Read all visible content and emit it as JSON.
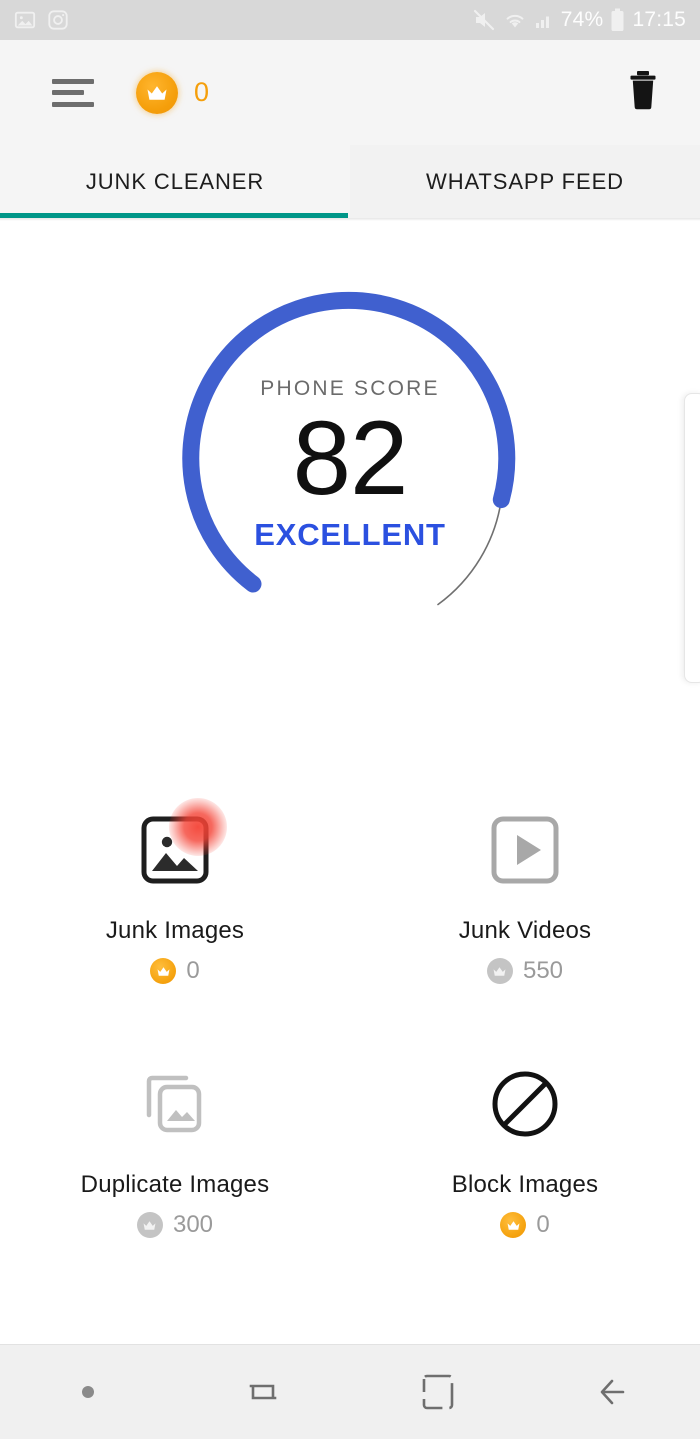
{
  "status_bar": {
    "left_icons": [
      "gallery-icon",
      "camera-icon"
    ],
    "mute_icon": "mute-icon",
    "wifi_icon": "wifi-icon",
    "signal_icon": "cellular-signal-icon",
    "battery_percent": "74%",
    "battery_icon": "battery-icon",
    "time": "17:15"
  },
  "toolbar": {
    "menu_icon": "hamburger-menu-icon",
    "crown_icon": "crown-icon",
    "crown_count": "0",
    "delete_icon": "trash-icon",
    "accent_orange": "#f59f0b"
  },
  "tabs": {
    "active_index": 0,
    "underline_color": "#009688",
    "items": [
      {
        "label": "JUNK CLEANER"
      },
      {
        "label": "WHATSAPP FEED"
      }
    ]
  },
  "gauge": {
    "label": "PHONE SCORE",
    "value": "82",
    "status": "EXCELLENT",
    "arc_color": "#4060cf",
    "track_color": "#707070",
    "status_color": "#2b50e0",
    "percent": 82
  },
  "tiles": [
    {
      "label": "Junk Images",
      "count": "0",
      "icon": "image-icon",
      "badge": "crown-icon",
      "badge_style": "gold",
      "has_alert": true
    },
    {
      "label": "Junk Videos",
      "count": "550",
      "icon": "video-play-icon",
      "badge": "crown-icon",
      "badge_style": "gray",
      "has_alert": false
    },
    {
      "label": "Duplicate Images",
      "count": "300",
      "icon": "duplicate-images-icon",
      "badge": "crown-icon",
      "badge_style": "gray",
      "has_alert": false
    },
    {
      "label": "Block Images",
      "count": "0",
      "icon": "block-circle-slash-icon",
      "badge": "crown-icon",
      "badge_style": "gold",
      "has_alert": false
    }
  ],
  "nav_bar": {
    "items": [
      "dot-indicator",
      "recents-icon",
      "home-icon",
      "back-icon"
    ]
  }
}
